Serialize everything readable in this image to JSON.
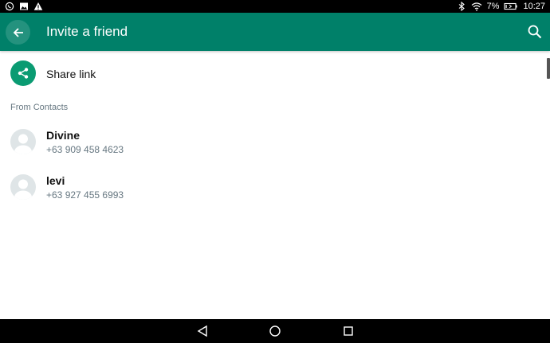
{
  "status_bar": {
    "battery": "7%",
    "time": "10:27",
    "left_icons": [
      "whatsapp-icon",
      "image-icon",
      "warning-icon"
    ],
    "right_icons": [
      "bluetooth-icon",
      "wifi-icon",
      "battery-icon"
    ]
  },
  "toolbar": {
    "title": "Invite a friend",
    "back_icon": "arrow-left-icon",
    "search_icon": "search-icon",
    "color": "#008069"
  },
  "share": {
    "label": "Share link",
    "icon": "share-icon",
    "color": "#0a9b72"
  },
  "contacts_section": {
    "header": "From Contacts",
    "contacts": [
      {
        "name": "Divine",
        "phone": "+63 909 458 4623"
      },
      {
        "name": "levi",
        "phone": "+63 927 455 6993"
      }
    ]
  },
  "nav_bar": {
    "buttons": [
      "back-triangle-icon",
      "home-circle-icon",
      "recents-square-icon"
    ]
  }
}
